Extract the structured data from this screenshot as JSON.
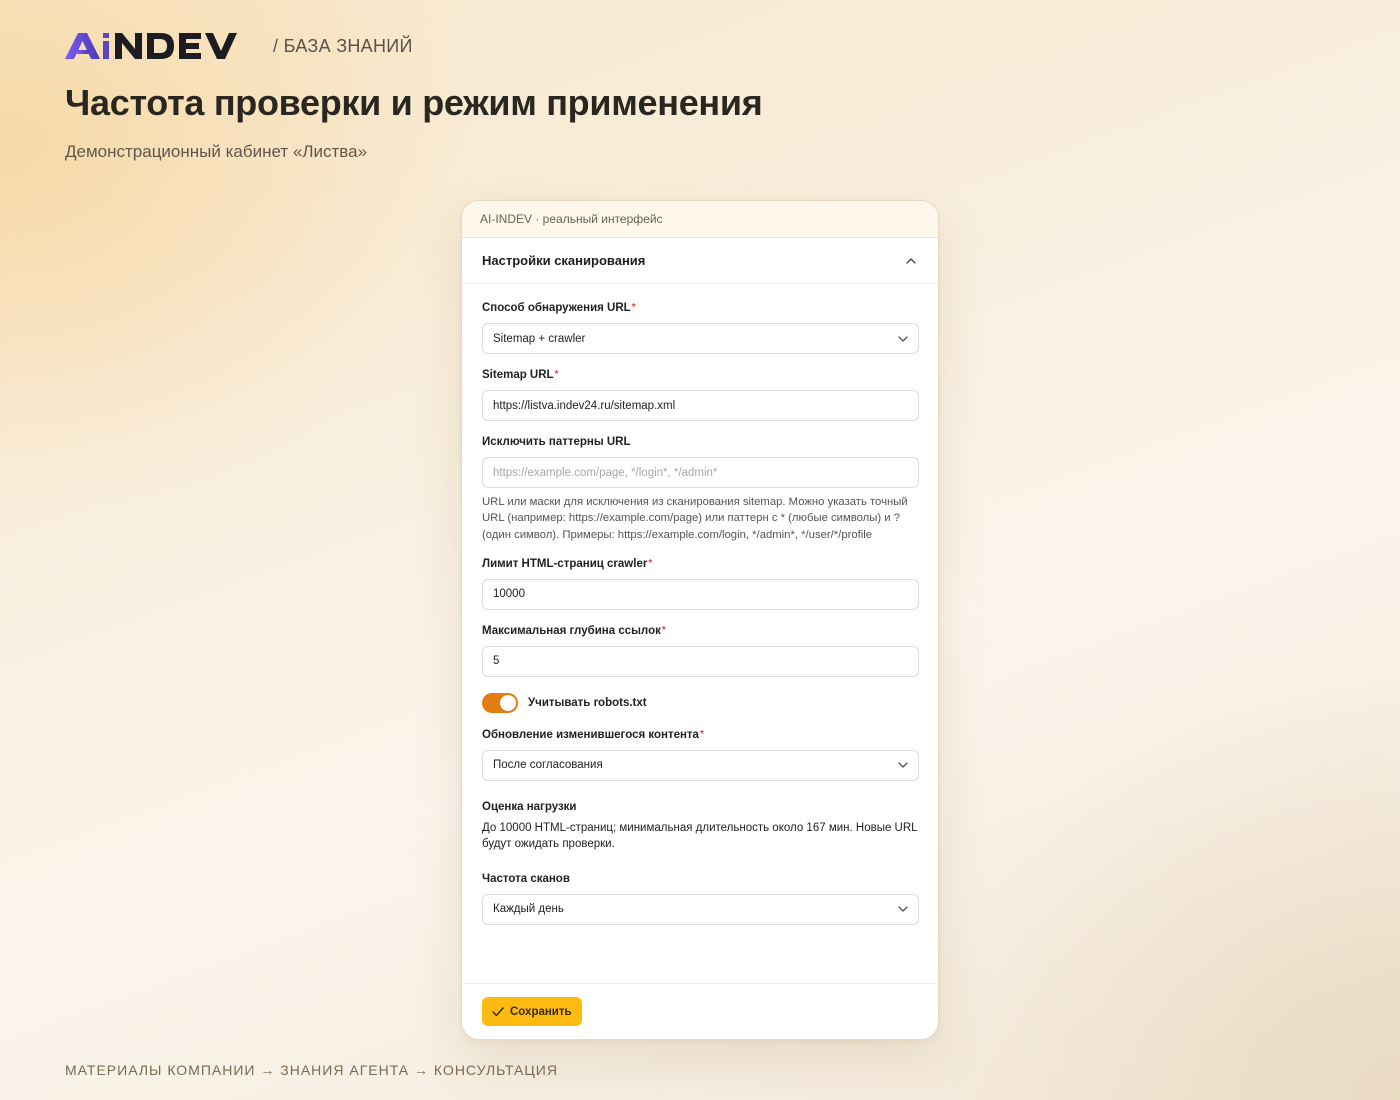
{
  "header": {
    "logo_text": "AiNDEV",
    "breadcrumb": "/ БАЗА ЗНАНИЙ",
    "title": "Частота проверки и режим применения",
    "subtitle": "Демонстрационный кабинет «Листва»"
  },
  "frame": {
    "bar_label": "AI-INDEV · реальный интерфейс",
    "section_title": "Настройки сканирования"
  },
  "form": {
    "discovery": {
      "label": "Способ обнаружения URL",
      "required_mark": "*",
      "value": "Sitemap + crawler"
    },
    "sitemap": {
      "label": "Sitemap URL",
      "required_mark": "*",
      "value": "https://listva.indev24.ru/sitemap.xml"
    },
    "exclude": {
      "label": "Исключить паттерны URL",
      "placeholder": "https://example.com/page, */login*, */admin*",
      "hint": "URL или маски для исключения из сканирования sitemap. Можно указать точный URL (например: https://example.com/page) или паттерн с * (любые символы) и ? (один символ). Примеры: https://example.com/login, */admin*, */user/*/profile"
    },
    "page_limit": {
      "label": "Лимит HTML-страниц crawler",
      "required_mark": "*",
      "value": "10000"
    },
    "depth": {
      "label": "Максимальная глубина ссылок",
      "required_mark": "*",
      "value": "5"
    },
    "robots": {
      "label": "Учитывать robots.txt",
      "enabled": true
    },
    "update_mode": {
      "label": "Обновление изменившегося контента",
      "required_mark": "*",
      "value": "После согласования"
    },
    "load": {
      "title": "Оценка нагрузки",
      "text": "До 10000 HTML-страниц; минимальная длительность около 167 мин. Новые URL будут ожидать проверки."
    },
    "frequency": {
      "label": "Частота сканов",
      "value": "Каждый день"
    }
  },
  "actions": {
    "save_label": "Сохранить"
  },
  "footer": {
    "path": "МАТЕРИАЛЫ КОМПАНИИ → ЗНАНИЯ АГЕНТА → КОНСУЛЬТАЦИЯ"
  },
  "colors": {
    "accent_toggle": "#e27d12",
    "save_button": "#fdbb12",
    "required": "#e5453b",
    "logo_purple": "#5b45c4"
  },
  "icons": [
    "chevron-up-icon",
    "chevron-down-icon",
    "check-icon"
  ]
}
